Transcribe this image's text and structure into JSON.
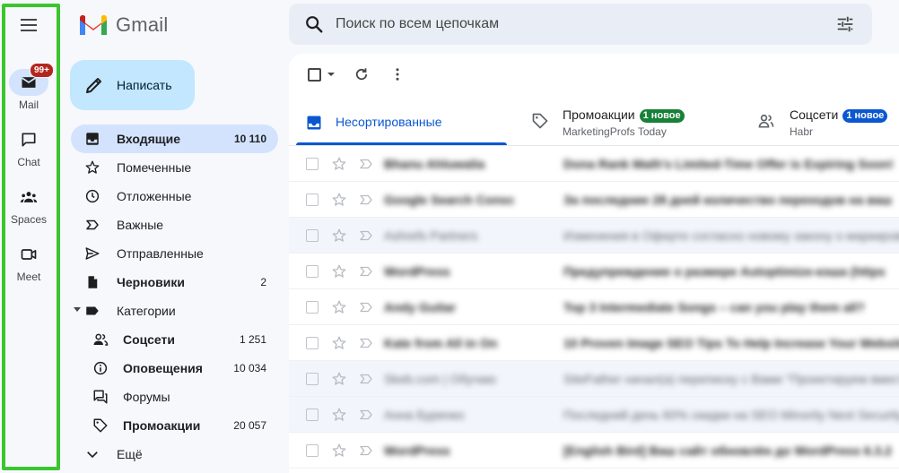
{
  "rail": {
    "items": [
      {
        "label": "Mail",
        "badge": "99+",
        "icon": "mail-icon",
        "active": true
      },
      {
        "label": "Chat",
        "icon": "chat-icon"
      },
      {
        "label": "Spaces",
        "icon": "spaces-icon"
      },
      {
        "label": "Meet",
        "icon": "meet-icon"
      }
    ]
  },
  "header": {
    "logo_text": "Gmail",
    "search_placeholder": "Поиск по всем цепочкам"
  },
  "compose": {
    "label": "Написать"
  },
  "nav": {
    "inbox": {
      "label": "Входящие",
      "count": "10 110"
    },
    "starred": {
      "label": "Помеченные"
    },
    "snoozed": {
      "label": "Отложенные"
    },
    "important": {
      "label": "Важные"
    },
    "sent": {
      "label": "Отправленные"
    },
    "drafts": {
      "label": "Черновики",
      "count": "2"
    },
    "categories": {
      "label": "Категории"
    },
    "social": {
      "label": "Соцсети",
      "count": "1 251"
    },
    "updates": {
      "label": "Оповещения",
      "count": "10 034"
    },
    "forums": {
      "label": "Форумы"
    },
    "promotions": {
      "label": "Промоакции",
      "count": "20 057"
    },
    "more": {
      "label": "Ещё"
    }
  },
  "tabs": {
    "primary": {
      "label": "Несортированные"
    },
    "promotions": {
      "label": "Промоакции",
      "badge": "1 новое",
      "sender": "MarketingProfs Today"
    },
    "social": {
      "label": "Соцсети",
      "badge": "1 новое",
      "sender": "Habr"
    }
  },
  "colors": {
    "accent": "#0b57d0",
    "promo_badge": "#188038",
    "social_badge": "#0b57d0",
    "rail_highlight": "#3cc52f",
    "mail_badge": "#b3261e"
  },
  "emails": [
    {
      "sender": "Bhanu Ahluwalia",
      "subject": "Dona Rank Math's Limited-Time Offer is Expiring Soon!",
      "unread": true
    },
    {
      "sender": "Google Search Consc",
      "subject": "За последние 28 дней количество переходов на ваш",
      "unread": true
    },
    {
      "sender": "Ashrefs Partners",
      "subject": "Изменения в Оферте согласно новому закону о маркировке",
      "unread": false
    },
    {
      "sender": "WordPress",
      "subject": "Предупреждение о размере Autoptimize-кэша (https",
      "unread": true
    },
    {
      "sender": "Andy Guitar",
      "subject": "Top 3 Intermediate Songs – can you play them all?",
      "unread": true
    },
    {
      "sender": "Kate from All in On",
      "subject": "10 Proven Image SEO Tips To Help Increase Your Website",
      "unread": true
    },
    {
      "sender": "Skeb.com | Обучаю",
      "subject": "SiteFather начал(а) переписку с Вами \"Проектируем вместе",
      "unread": false
    },
    {
      "sender": "Анна Буренко",
      "subject": "Последний день 60% скидки на SEO Minority Next Security",
      "unread": false
    },
    {
      "sender": "WordPress",
      "subject": "[English Bird] Ваш сайт обновлён до WordPress 6.3.2",
      "unread": true
    }
  ]
}
